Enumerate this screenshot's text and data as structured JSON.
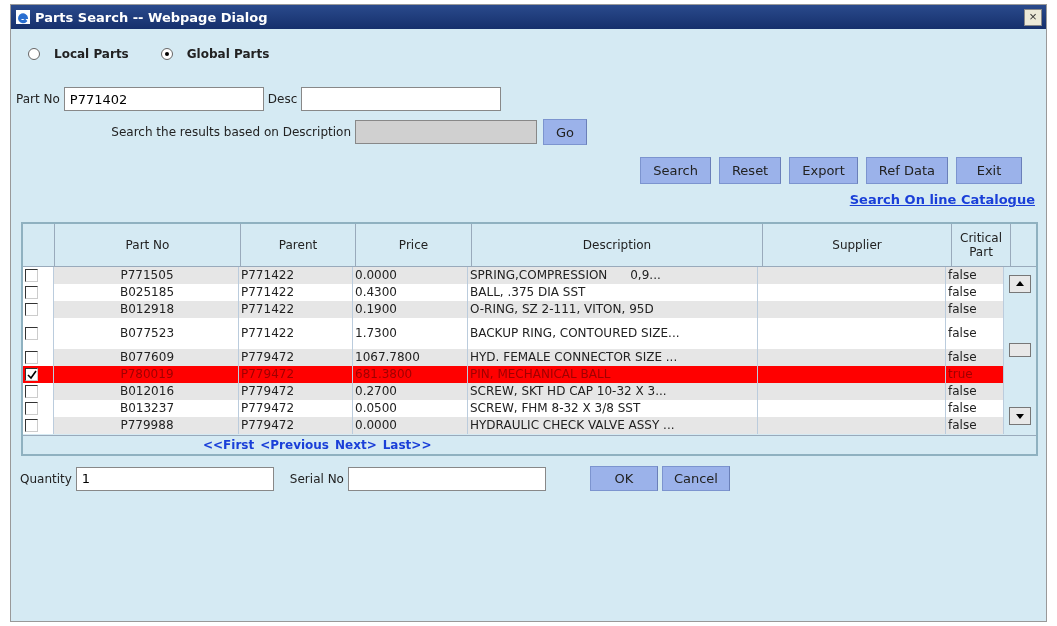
{
  "window": {
    "title": "Parts Search -- Webpage Dialog",
    "close": "×"
  },
  "scope": [
    {
      "label": "Local Parts",
      "selected": false
    },
    {
      "label": "Global Parts",
      "selected": true
    }
  ],
  "part_no": {
    "label": "Part No",
    "value": "P771402"
  },
  "desc": {
    "label": "Desc"
  },
  "filter": {
    "label": "Search the results based on Description",
    "button": "Go",
    "disabled": true
  },
  "buttons": [
    "Search",
    "Reset",
    "Export",
    "Ref Data",
    "Exit"
  ],
  "catalogue_link": "Search On line Catalogue",
  "table": {
    "columns": [
      "Part No",
      "Parent",
      "Price",
      "Description",
      "Supplier",
      "Critical Part"
    ],
    "rows": [
      {
        "checked": false,
        "selected": false,
        "part_no": "P771505",
        "parent": "P771422",
        "price": "0.0000",
        "description": "SPRING,COMPRESSION      0,9...",
        "critical": "false"
      },
      {
        "checked": false,
        "selected": false,
        "part_no": "B025185",
        "parent": "P771422",
        "price": "0.4300",
        "description": "BALL, .375 DIA SST",
        "critical": "false"
      },
      {
        "checked": false,
        "selected": false,
        "part_no": "B012918",
        "parent": "P771422",
        "price": "0.1900",
        "description": "O-RING, SZ 2-111, VITON, 95D",
        "critical": "false"
      },
      {
        "checked": false,
        "selected": false,
        "part_no": "B077523",
        "parent": "P771422",
        "price": "1.7300",
        "description": "BACKUP RING, CONTOURED SIZE...",
        "critical": "false"
      },
      {
        "checked": false,
        "selected": false,
        "part_no": "B077609",
        "parent": "P779472",
        "price": "1067.7800",
        "description": "HYD. FEMALE CONNECTOR SIZE ...",
        "critical": "false"
      },
      {
        "checked": true,
        "selected": true,
        "part_no": "P780019",
        "parent": "P779472",
        "price": "681.3800",
        "description": "PIN, MECHANICAL BALL",
        "critical": "true"
      },
      {
        "checked": false,
        "selected": false,
        "part_no": "B012016",
        "parent": "P779472",
        "price": "0.2700",
        "description": "SCREW, SKT HD CAP 10-32 X 3...",
        "critical": "false"
      },
      {
        "checked": false,
        "selected": false,
        "part_no": "B013237",
        "parent": "P779472",
        "price": "0.0500",
        "description": "SCREW, FHM 8-32 X 3/8 SST",
        "critical": "false"
      },
      {
        "checked": false,
        "selected": false,
        "part_no": "P779988",
        "parent": "P779472",
        "price": "0.0000",
        "description": "HYDRAULIC CHECK VALVE ASSY ...",
        "critical": "false"
      }
    ]
  },
  "pager": [
    "<<First",
    "<Previous",
    "Next>",
    "Last>>"
  ],
  "quantity": {
    "label": "Quantity",
    "value": "1"
  },
  "serial_no": {
    "label": "Serial No"
  },
  "dialog_buttons": [
    "OK",
    "Cancel"
  ]
}
